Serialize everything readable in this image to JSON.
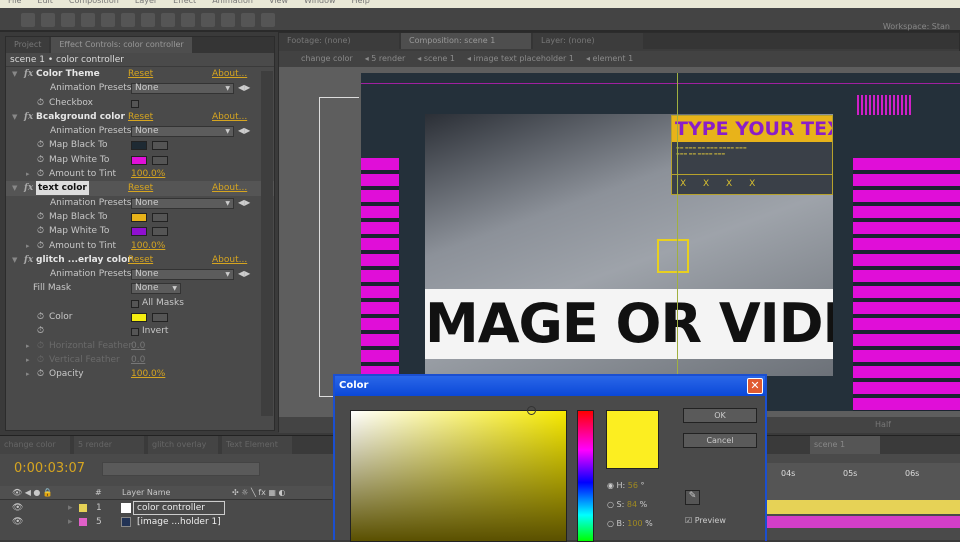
{
  "menu": [
    "File",
    "Edit",
    "Composition",
    "Layer",
    "Effect",
    "Animation",
    "View",
    "Window",
    "Help"
  ],
  "workspace_label": "Workspace:  Stan",
  "left_panel": {
    "tabs": [
      "Project",
      "Effect Controls: color controller"
    ],
    "header": "scene 1 • color controller",
    "effects": [
      {
        "name": "Color Theme",
        "reset": "Reset",
        "about": "About...",
        "props": [
          {
            "label": "Animation Presets:",
            "value": "None",
            "type": "dropdown"
          },
          {
            "label": "Checkbox",
            "type": "checkbox"
          }
        ]
      },
      {
        "name": "Bcakground color",
        "reset": "Reset",
        "about": "About...",
        "props": [
          {
            "label": "Animation Presets:",
            "value": "None",
            "type": "dropdown"
          },
          {
            "label": "Map Black To",
            "type": "color",
            "color": "#1e2a33"
          },
          {
            "label": "Map White To",
            "type": "color",
            "color": "#e010d8"
          },
          {
            "label": "Amount to Tint",
            "value": "100.0%",
            "type": "value"
          }
        ]
      },
      {
        "name": "text color",
        "reset": "Reset",
        "about": "About...",
        "props": [
          {
            "label": "Animation Presets:",
            "value": "None",
            "type": "dropdown"
          },
          {
            "label": "Map Black To",
            "type": "color",
            "color": "#e8b31a"
          },
          {
            "label": "Map White To",
            "type": "color",
            "color": "#9010d0"
          },
          {
            "label": "Amount to Tint",
            "value": "100.0%",
            "type": "value"
          }
        ]
      },
      {
        "name": "glitch ...erlay color",
        "reset": "Reset",
        "about": "About...",
        "props": [
          {
            "label": "Animation Presets:",
            "value": "None",
            "type": "dropdown"
          },
          {
            "label": "Fill Mask",
            "value": "None",
            "type": "dropdown"
          },
          {
            "label": "All Masks",
            "type": "checkbox"
          },
          {
            "label": "Color",
            "type": "color",
            "color": "#f5ee10"
          },
          {
            "label": "Invert",
            "type": "checkbox"
          },
          {
            "label": "Horizontal Feather",
            "value": "0.0",
            "type": "value",
            "disabled": true
          },
          {
            "label": "Vertical Feather",
            "value": "0.0",
            "type": "value",
            "disabled": true
          },
          {
            "label": "Opacity",
            "value": "100.0%",
            "type": "value"
          }
        ]
      }
    ]
  },
  "comp": {
    "tabs": [
      "Footage: (none)",
      "Composition: scene 1",
      "Layer: (none)"
    ],
    "breadcrumbs": [
      "change color",
      "5 render",
      "scene 1",
      "image text placeholder 1",
      "element 1"
    ],
    "image_text": "MAGE OR VIDE",
    "title_text": "TYPE YOUR TEXT",
    "x_row": "X X X X",
    "zoom": "Half"
  },
  "timeline": {
    "tabs": [
      "change color",
      "5 render",
      "glitch overlay",
      "Text Element",
      "scene 1"
    ],
    "timecode": "0:00:03:07",
    "col_header": {
      "num": "#",
      "layer_name": "Layer Name"
    },
    "layers": [
      {
        "num": "1",
        "name": "color controller",
        "label_color": "#e6d256"
      },
      {
        "num": "5",
        "name": "[image ...holder 1]",
        "label_color": "#e060c8"
      }
    ],
    "ruler": [
      "04s",
      "05s",
      "06s"
    ]
  },
  "dialog": {
    "title": "Color",
    "ok": "OK",
    "cancel": "Cancel",
    "h_label": "H:",
    "h_value": "56",
    "h_unit": "°",
    "s_label": "S:",
    "s_value": "84",
    "s_unit": "%",
    "b_label": "B:",
    "b_value": "100",
    "b_unit": "%",
    "preview": "Preview",
    "current_color": "#fcee21"
  }
}
